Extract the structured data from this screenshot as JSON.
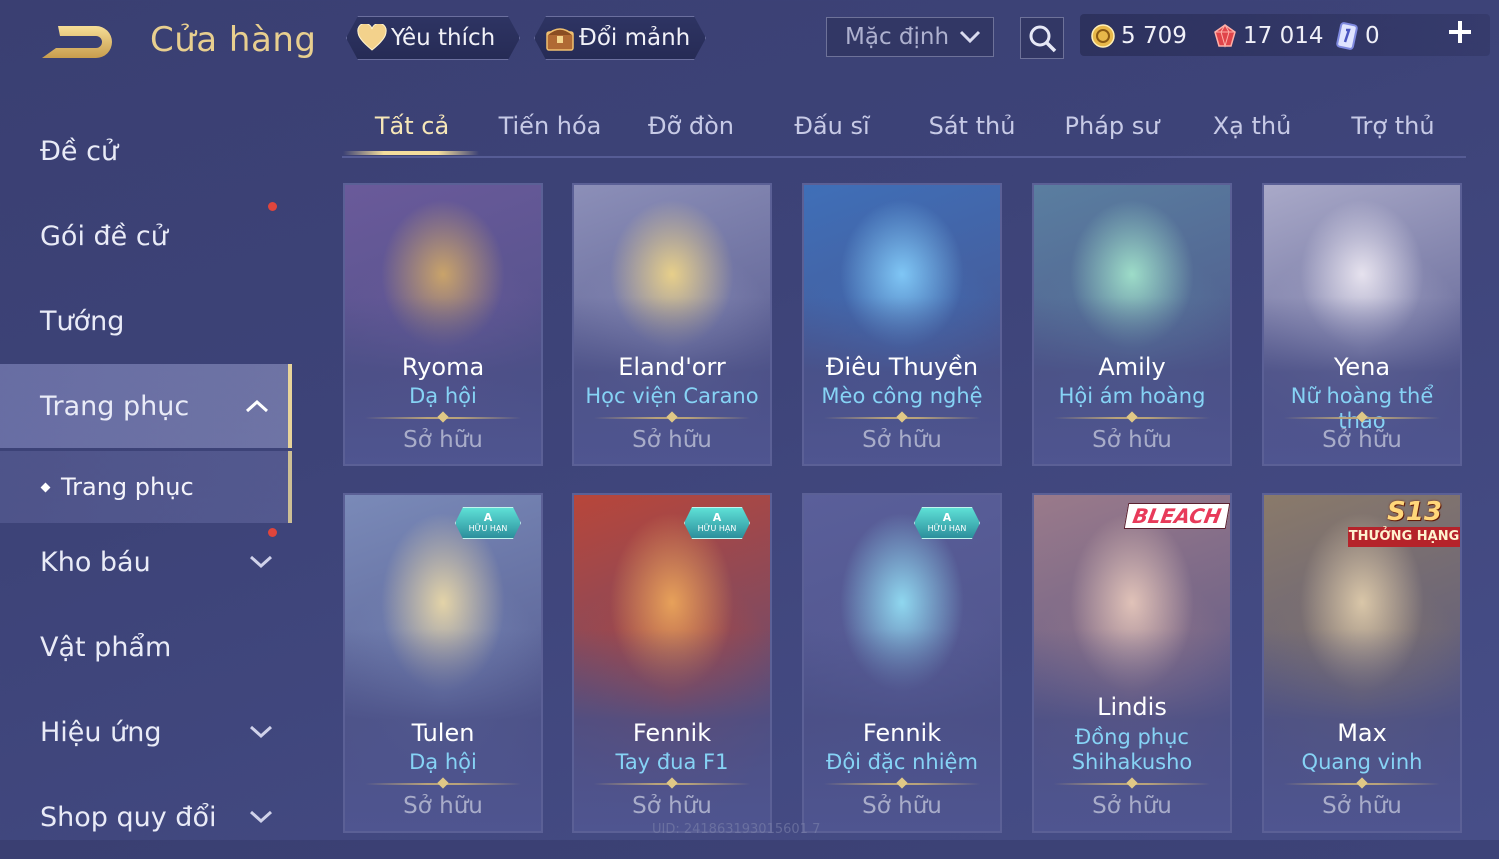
{
  "header": {
    "title": "Cửa hàng",
    "favorite_label": "Yêu thích",
    "exchange_label": "Đổi mảnh",
    "sort_value": "Mặc định"
  },
  "currencies": [
    {
      "name": "gold-coin",
      "value": "5 709"
    },
    {
      "name": "ruby-gem",
      "value": "17 014"
    },
    {
      "name": "card-ticket",
      "value": "0"
    }
  ],
  "sidebar": {
    "items": [
      {
        "label": "Đề cử"
      },
      {
        "label": "Gói đề cử"
      },
      {
        "label": "Tướng"
      },
      {
        "label": "Trang phục"
      },
      {
        "label": "Trang phục"
      },
      {
        "label": "Kho báu"
      },
      {
        "label": "Vật phẩm"
      },
      {
        "label": "Hiệu ứng"
      },
      {
        "label": "Shop quy đổi"
      }
    ]
  },
  "tabs": [
    "Tất cả",
    "Tiến hóa",
    "Đỡ đòn",
    "Đấu sĩ",
    "Sát thủ",
    "Pháp sư",
    "Xạ thủ",
    "Trợ thủ"
  ],
  "cards": [
    {
      "hero": "Ryoma",
      "skin": "Dạ hội",
      "status": "Sở hữu",
      "badge": "",
      "theme": [
        "#6a5a9a",
        "#c9a36a"
      ]
    },
    {
      "hero": "Eland'orr",
      "skin": "Học viện Carano",
      "status": "Sở hữu",
      "badge": "",
      "theme": [
        "#8c8fb8",
        "#e7cf8a"
      ]
    },
    {
      "hero": "Điêu Thuyền",
      "skin": "Mèo công nghệ",
      "status": "Sở hữu",
      "badge": "",
      "theme": [
        "#3f6fb8",
        "#7fc6f5"
      ]
    },
    {
      "hero": "Amily",
      "skin": "Hội ám hoàng",
      "status": "Sở hữu",
      "badge": "",
      "theme": [
        "#5a7ea0",
        "#9ddcc8"
      ]
    },
    {
      "hero": "Yena",
      "skin": "Nữ hoàng thể thao",
      "status": "Sở hữu",
      "badge": "",
      "theme": [
        "#a9a9c8",
        "#e6e2ee"
      ]
    },
    {
      "hero": "Tulen",
      "skin": "Dạ hội",
      "status": "Sở hữu",
      "badge": "A",
      "theme": [
        "#7a8ab8",
        "#e3d3a8"
      ]
    },
    {
      "hero": "Fennik",
      "skin": "Tay đua F1",
      "status": "Sở hữu",
      "badge": "A",
      "theme": [
        "#b8463a",
        "#e7a15a"
      ]
    },
    {
      "hero": "Fennik",
      "skin": "Đội đặc nhiệm",
      "status": "Sở hữu",
      "badge": "A",
      "theme": [
        "#5a5f9a",
        "#8fd7ef"
      ]
    },
    {
      "hero": "Lindis",
      "skin": "Đồng phục Shihakusho",
      "status": "Sở hữu",
      "badge": "BLEACH",
      "theme": [
        "#9a7a8a",
        "#e0c2b8"
      ]
    },
    {
      "hero": "Max",
      "skin": "Quang vinh",
      "status": "Sở hữu",
      "badge": "S13",
      "theme": [
        "#8a7a6a",
        "#d9c6a8"
      ]
    }
  ],
  "badges": {
    "a_line1": "A",
    "a_line2": "HỮU HẠN",
    "bleach": "BLEACH",
    "s13": "S13",
    "s13_ribbon": "THƯỞNG HẠNG"
  },
  "uid": "UID: 241863193015601 7"
}
